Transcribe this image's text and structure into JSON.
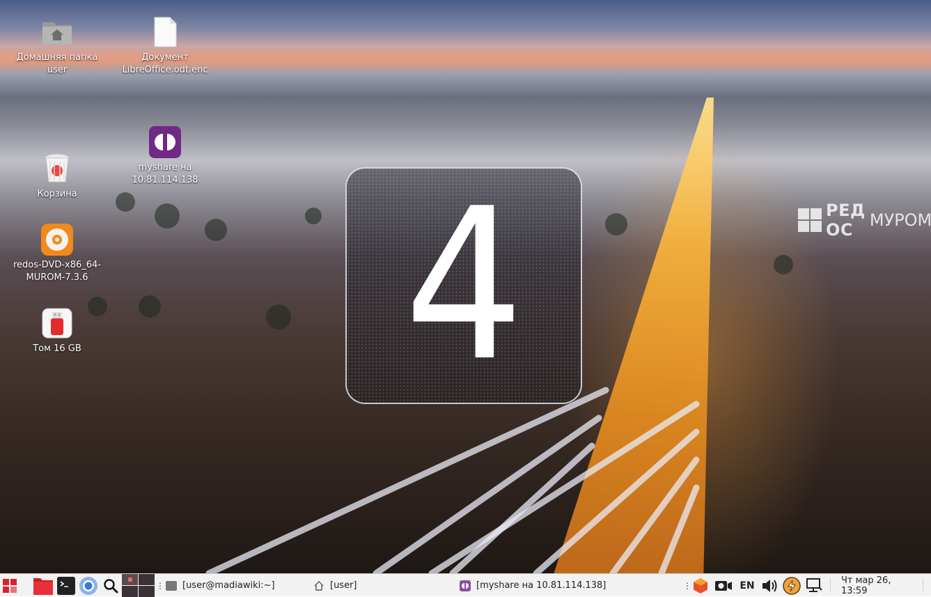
{
  "desktop": {
    "brand": {
      "bold": "РЕД ОС",
      "light": "МУРОМ"
    },
    "icons": [
      {
        "label": "Домашняя папка user",
        "icon": "home-folder-icon"
      },
      {
        "label": "Документ LibreOffice.odt.enc",
        "icon": "document-icon"
      },
      {
        "label": "Корзина",
        "icon": "trash-icon"
      },
      {
        "label": "myshare на 10.81.114.138",
        "icon": "network-share-icon"
      },
      {
        "label": "redos-DVD-x86_64-MUROM-7.3.6",
        "icon": "dvd-disc-icon"
      },
      {
        "label": "Том 16 GB",
        "icon": "usb-drive-icon"
      }
    ]
  },
  "workspace_osd": {
    "number": "4"
  },
  "taskbar": {
    "launchers": [
      {
        "name": "app-menu",
        "icon": "redos-menu-icon"
      },
      {
        "name": "file-manager",
        "icon": "folder-icon",
        "color": "#e8303a"
      },
      {
        "name": "terminal",
        "icon": "terminal-icon"
      },
      {
        "name": "browser",
        "icon": "chromium-icon"
      },
      {
        "name": "search",
        "icon": "search-icon"
      }
    ],
    "tasks": [
      {
        "label": "[user@madiawiki:~]",
        "icon": "terminal-icon"
      },
      {
        "label": "[user]",
        "icon": "home-icon"
      },
      {
        "label": "[myshare на 10.81.114.138]",
        "icon": "network-share-icon"
      }
    ],
    "tray": {
      "keyboard_layout": "EN",
      "icons": [
        "updates-icon",
        "camera-icon",
        "keyboard-layout",
        "volume-icon",
        "power-manager-icon",
        "network-icon"
      ]
    },
    "clock": "Чт мар 26, 13:59"
  }
}
